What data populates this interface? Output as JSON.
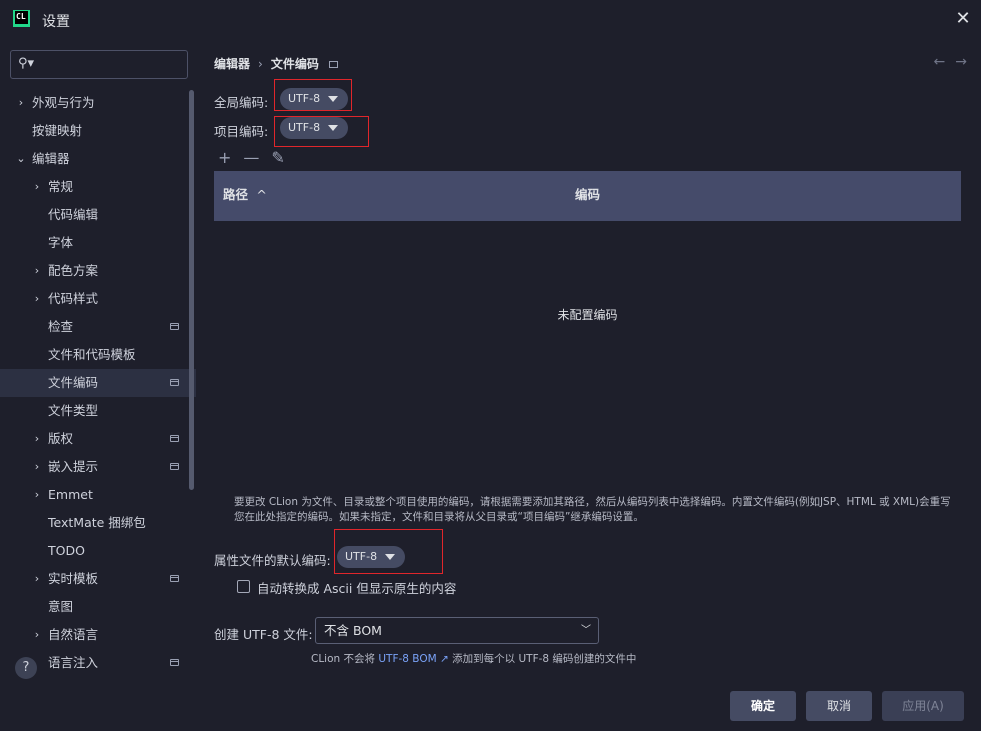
{
  "window": {
    "title": "设置"
  },
  "search": {
    "placeholder": ""
  },
  "sidebar": {
    "items": [
      {
        "label": "外观与行为",
        "arrow": "›",
        "expanded": false
      },
      {
        "label": "按键映射"
      },
      {
        "label": "编辑器",
        "arrow": "⌄",
        "expanded": true
      },
      {
        "label": "常规",
        "arrow": "›"
      },
      {
        "label": "代码编辑"
      },
      {
        "label": "字体"
      },
      {
        "label": "配色方案",
        "arrow": "›"
      },
      {
        "label": "代码样式",
        "arrow": "›"
      },
      {
        "label": "检查",
        "pinned": true
      },
      {
        "label": "文件和代码模板"
      },
      {
        "label": "文件编码",
        "pinned": true,
        "selected": true
      },
      {
        "label": "文件类型"
      },
      {
        "label": "版权",
        "arrow": "›",
        "pinned": true
      },
      {
        "label": "嵌入提示",
        "arrow": "›",
        "pinned": true
      },
      {
        "label": "Emmet",
        "arrow": "›"
      },
      {
        "label": "TextMate 捆绑包"
      },
      {
        "label": "TODO"
      },
      {
        "label": "实时模板",
        "arrow": "›",
        "pinned": true
      },
      {
        "label": "意图"
      },
      {
        "label": "自然语言",
        "arrow": "›"
      },
      {
        "label": "语言注入",
        "pinned": true
      }
    ]
  },
  "breadcrumb": {
    "parent": "编辑器",
    "separator": "›",
    "current": "文件编码"
  },
  "nav": {
    "back": "←",
    "forward": "→"
  },
  "global_encoding": {
    "label": "全局编码:",
    "value": "UTF-8"
  },
  "project_encoding": {
    "label": "项目编码:",
    "value": "UTF-8"
  },
  "toolbar": {
    "add": "+",
    "remove": "—",
    "edit": "✎"
  },
  "table": {
    "col_path": "路径",
    "sort_indicator": "^",
    "col_encoding": "编码",
    "empty_text": "未配置编码"
  },
  "note": "要更改 CLion 为文件、目录或整个项目使用的编码，请根据需要添加其路径，然后从编码列表中选择编码。内置文件编码(例如JSP、HTML 或 XML)会重写您在此处指定的编码。如果未指定，文件和目录将从父目录或“项目编码”继承编码设置。",
  "properties_encoding": {
    "label": "属性文件的默认编码:",
    "value": "UTF-8"
  },
  "transparent_ascii": {
    "label": "自动转换成 Ascii 但显示原生的内容",
    "checked": false
  },
  "bom": {
    "label": "创建 UTF-8 文件:",
    "value": "不含 BOM"
  },
  "hint": {
    "prefix": "CLion 不会将 ",
    "link": "UTF-8 BOM ↗",
    "suffix": " 添加到每个以 UTF-8 编码创建的文件中"
  },
  "buttons": {
    "ok": "确定",
    "cancel": "取消",
    "apply": "应用(A)"
  },
  "help": {
    "symbol": "?"
  },
  "colors": {
    "background": "#1e1f2b",
    "header": "#454b6a",
    "highlight_box": "#e0262b",
    "link": "#7aa2f7"
  }
}
